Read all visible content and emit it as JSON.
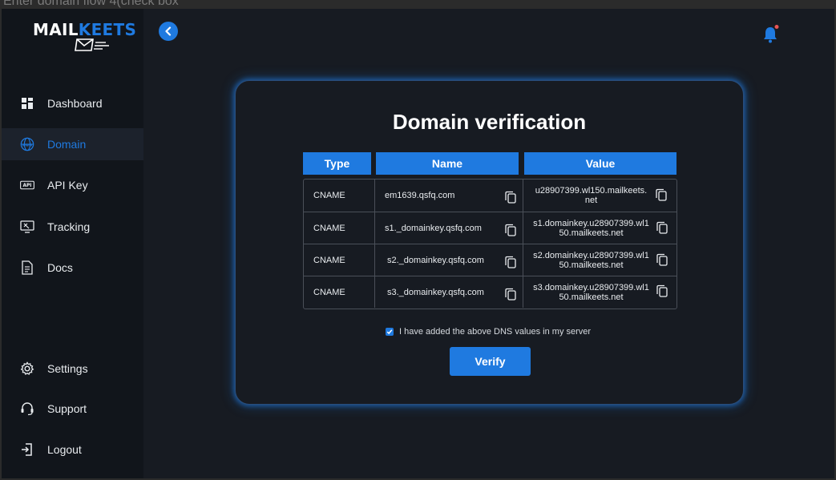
{
  "window": {
    "title": "Enter domain flow 4(check box"
  },
  "brand": {
    "name_part1": "MAIL",
    "name_part2": "KEETS",
    "accent": "#1f7ae0"
  },
  "sidebar": {
    "items": [
      {
        "label": "Dashboard",
        "icon": "dashboard-icon",
        "active": false
      },
      {
        "label": "Domain",
        "icon": "globe-icon",
        "active": true
      },
      {
        "label": "API Key",
        "icon": "api-icon",
        "active": false
      },
      {
        "label": "Tracking",
        "icon": "tracking-icon",
        "active": false
      },
      {
        "label": "Docs",
        "icon": "document-icon",
        "active": false
      }
    ],
    "bottom_items": [
      {
        "label": "Settings",
        "icon": "gear-icon"
      },
      {
        "label": "Support",
        "icon": "headset-icon"
      },
      {
        "label": "Logout",
        "icon": "logout-icon"
      }
    ]
  },
  "header": {
    "back_icon": "chevron-left-icon",
    "notification_icon": "bell-icon",
    "notification_dot_color": "#e85555"
  },
  "card": {
    "title": "Domain verification",
    "table": {
      "headers": {
        "type": "Type",
        "name": "Name",
        "value": "Value"
      },
      "rows": [
        {
          "type": "CNAME",
          "name": "em1639.qsfq.com",
          "value": "u28907399.wl150.mailkeets.net"
        },
        {
          "type": "CNAME",
          "name": "s1._domainkey.qsfq.com",
          "value": "s1.domainkey.u28907399.wl150.mailkeets.net"
        },
        {
          "type": "CNAME",
          "name": "s2._domainkey.qsfq.com",
          "value": "s2.domainkey.u28907399.wl150.mailkeets.net"
        },
        {
          "type": "CNAME",
          "name": "s3._domainkey.qsfq.com",
          "value": "s3.domainkey.u28907399.wl150.mailkeets.net"
        }
      ]
    },
    "confirm_label": "I have added the above DNS values in my server",
    "confirm_checked": true,
    "verify_label": "Verify"
  }
}
